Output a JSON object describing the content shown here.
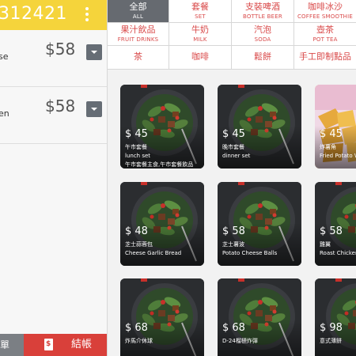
{
  "order": {
    "number": "312421",
    "items": [
      {
        "name": "se",
        "price": "$58"
      },
      {
        "name": "en",
        "price": "$58"
      }
    ]
  },
  "actions": {
    "order_label": "單",
    "checkout_label": "結帳"
  },
  "categories": [
    {
      "zh": "全部",
      "en": "ALL",
      "active": true
    },
    {
      "zh": "套餐",
      "en": "SET"
    },
    {
      "zh": "支裝啤酒",
      "en": "BOTTLE BEER"
    },
    {
      "zh": "咖啡冰沙",
      "en": "COFFEE SMOOTHIE"
    },
    {
      "zh": "果汁飲品",
      "en": "FRUIT DRINKS"
    },
    {
      "zh": "牛奶",
      "en": "MILK"
    },
    {
      "zh": "汽泡",
      "en": "SODA"
    },
    {
      "zh": "壺茶",
      "en": "POT TEA"
    },
    {
      "zh": "茶",
      "en": ""
    },
    {
      "zh": "咖啡",
      "en": ""
    },
    {
      "zh": "鬆餅",
      "en": ""
    },
    {
      "zh": "手工即制點品",
      "en": ""
    }
  ],
  "products": [
    {
      "price": "$ 45",
      "zh": "午市套餐",
      "en": "lunch set",
      "extra": "午市套餐主食,午市套餐飲品",
      "image": "salad"
    },
    {
      "price": "$ 45",
      "zh": "晚市套餐",
      "en": "dinner set",
      "image": "salad"
    },
    {
      "price": "$ 45",
      "zh": "炸薯角",
      "en": "Fried Potato Wedges",
      "image": "potato"
    },
    {
      "price": "$ 48",
      "zh": "芝士蒜蓉包",
      "en": "Cheese Garlic Bread",
      "image": "salad"
    },
    {
      "price": "$ 58",
      "zh": "芝士薯波",
      "en": "Potato Cheese Balls",
      "image": "salad"
    },
    {
      "price": "$ 58",
      "zh": "雞翼",
      "en": "Roast Chicken Wings",
      "image": "salad"
    },
    {
      "price": "$ 68",
      "zh": "炸馬介休球",
      "en": "",
      "image": "salad"
    },
    {
      "price": "$ 68",
      "zh": "D-24榴槤炸彈",
      "en": "",
      "image": "salad"
    },
    {
      "price": "$ 98",
      "zh": "意式薄餅",
      "en": "",
      "image": "salad"
    }
  ],
  "colors": {
    "header": "#f5d43b",
    "checkout": "#d9403a",
    "category_text": "#d94a4a",
    "category_active": "#666a70"
  }
}
